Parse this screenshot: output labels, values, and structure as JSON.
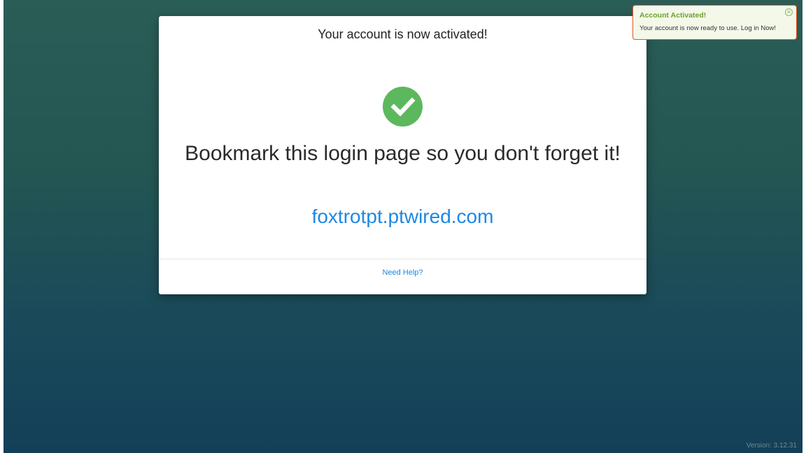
{
  "card": {
    "header": "Your account is now activated!",
    "check_icon": "check-circle-icon",
    "bookmark_message": "Bookmark this login page so you don't forget it!",
    "login_url": "foxtrotpt.ptwired.com",
    "help_link": "Need Help?"
  },
  "toast": {
    "title": "Account Activated!",
    "message": "Your account is now ready to use. Log in Now!",
    "close_icon": "close-circle-icon"
  },
  "footer": {
    "version": "Version: 3.12.31"
  },
  "colors": {
    "success_green": "#5cb85c",
    "link_blue": "#1e88e5",
    "toast_border": "#e8541e",
    "toast_title": "#6aa32a"
  }
}
